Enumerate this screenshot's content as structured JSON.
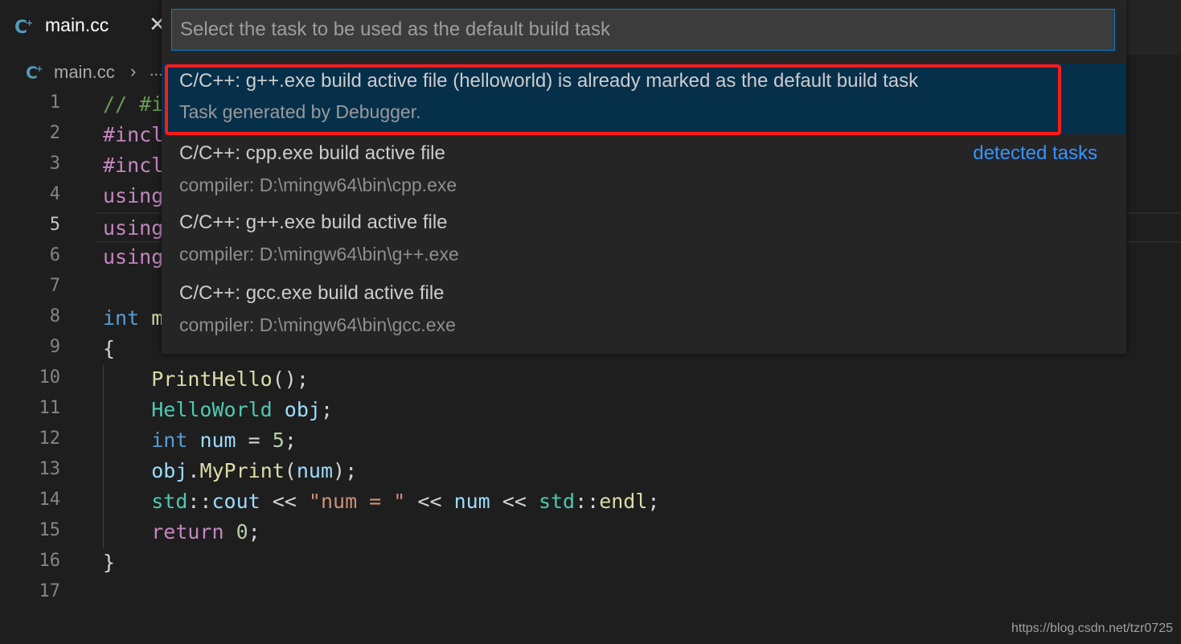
{
  "colors": {
    "keyword": "#569cd6",
    "control": "#c586c0",
    "function": "#dcdcaa",
    "type": "#4ec9b0",
    "variable": "#9cdcfe",
    "string": "#ce9178",
    "number": "#b5cea8",
    "comment": "#6a9955",
    "plain": "#d4d4d4",
    "accent": "#3794ff",
    "highlight": "#ff1a1a"
  },
  "tab": {
    "label": "main.cc",
    "icon": "cpp-file-icon",
    "close_icon": "close-icon",
    "close_glyph": "✕"
  },
  "breadcrumb": {
    "file": "main.cc",
    "separator": "›",
    "more": "..."
  },
  "quickpick": {
    "placeholder": "Select the task to be used as the default build task",
    "items": [
      {
        "label": "C/C++: g++.exe build active file (helloworld) is already marked as the default build task",
        "detail": "Task generated by Debugger.",
        "group": "",
        "selected": true
      },
      {
        "label": "C/C++: cpp.exe build active file",
        "detail": "compiler: D:\\mingw64\\bin\\cpp.exe",
        "group": "detected tasks",
        "selected": false
      },
      {
        "label": "C/C++: g++.exe build active file",
        "detail": "compiler: D:\\mingw64\\bin\\g++.exe",
        "group": "",
        "selected": false
      },
      {
        "label": "C/C++: gcc.exe build active file",
        "detail": "compiler: D:\\mingw64\\bin\\gcc.exe",
        "group": "",
        "selected": false
      }
    ]
  },
  "editor": {
    "active_line": 5,
    "lines": [
      {
        "n": "1",
        "tokens": [
          [
            "comment",
            "// #i"
          ]
        ]
      },
      {
        "n": "2",
        "tokens": [
          [
            "control",
            "#incl"
          ]
        ]
      },
      {
        "n": "3",
        "tokens": [
          [
            "control",
            "#incl"
          ]
        ]
      },
      {
        "n": "4",
        "tokens": [
          [
            "control",
            "using"
          ]
        ]
      },
      {
        "n": "5",
        "tokens": [
          [
            "control",
            "using"
          ]
        ]
      },
      {
        "n": "6",
        "tokens": [
          [
            "control",
            "using"
          ]
        ]
      },
      {
        "n": "7",
        "tokens": []
      },
      {
        "n": "8",
        "tokens": [
          [
            "keyword",
            "int"
          ],
          [
            "plain",
            " "
          ],
          [
            "function",
            "m"
          ]
        ]
      },
      {
        "n": "9",
        "tokens": [
          [
            "plain",
            "{"
          ]
        ]
      },
      {
        "n": "10",
        "tokens": [
          [
            "plain",
            "    "
          ],
          [
            "function",
            "PrintHello"
          ],
          [
            "plain",
            "();"
          ]
        ]
      },
      {
        "n": "11",
        "tokens": [
          [
            "plain",
            "    "
          ],
          [
            "type",
            "HelloWorld"
          ],
          [
            "plain",
            " "
          ],
          [
            "variable",
            "obj"
          ],
          [
            "plain",
            ";"
          ]
        ]
      },
      {
        "n": "12",
        "tokens": [
          [
            "plain",
            "    "
          ],
          [
            "keyword",
            "int"
          ],
          [
            "plain",
            " "
          ],
          [
            "variable",
            "num"
          ],
          [
            "plain",
            " = "
          ],
          [
            "number",
            "5"
          ],
          [
            "plain",
            ";"
          ]
        ]
      },
      {
        "n": "13",
        "tokens": [
          [
            "plain",
            "    "
          ],
          [
            "variable",
            "obj"
          ],
          [
            "plain",
            "."
          ],
          [
            "function",
            "MyPrint"
          ],
          [
            "plain",
            "("
          ],
          [
            "variable",
            "num"
          ],
          [
            "plain",
            ");"
          ]
        ]
      },
      {
        "n": "14",
        "tokens": [
          [
            "plain",
            "    "
          ],
          [
            "type",
            "std"
          ],
          [
            "plain",
            "::"
          ],
          [
            "variable",
            "cout"
          ],
          [
            "plain",
            " << "
          ],
          [
            "string",
            "\"num = \""
          ],
          [
            "plain",
            " << "
          ],
          [
            "variable",
            "num"
          ],
          [
            "plain",
            " << "
          ],
          [
            "type",
            "std"
          ],
          [
            "plain",
            "::"
          ],
          [
            "function",
            "endl"
          ],
          [
            "plain",
            ";"
          ]
        ]
      },
      {
        "n": "15",
        "tokens": [
          [
            "plain",
            "    "
          ],
          [
            "control",
            "return"
          ],
          [
            "plain",
            " "
          ],
          [
            "number",
            "0"
          ],
          [
            "plain",
            ";"
          ]
        ]
      },
      {
        "n": "16",
        "tokens": [
          [
            "plain",
            "}"
          ]
        ]
      },
      {
        "n": "17",
        "tokens": []
      }
    ]
  },
  "watermark": "https://blog.csdn.net/tzr0725"
}
